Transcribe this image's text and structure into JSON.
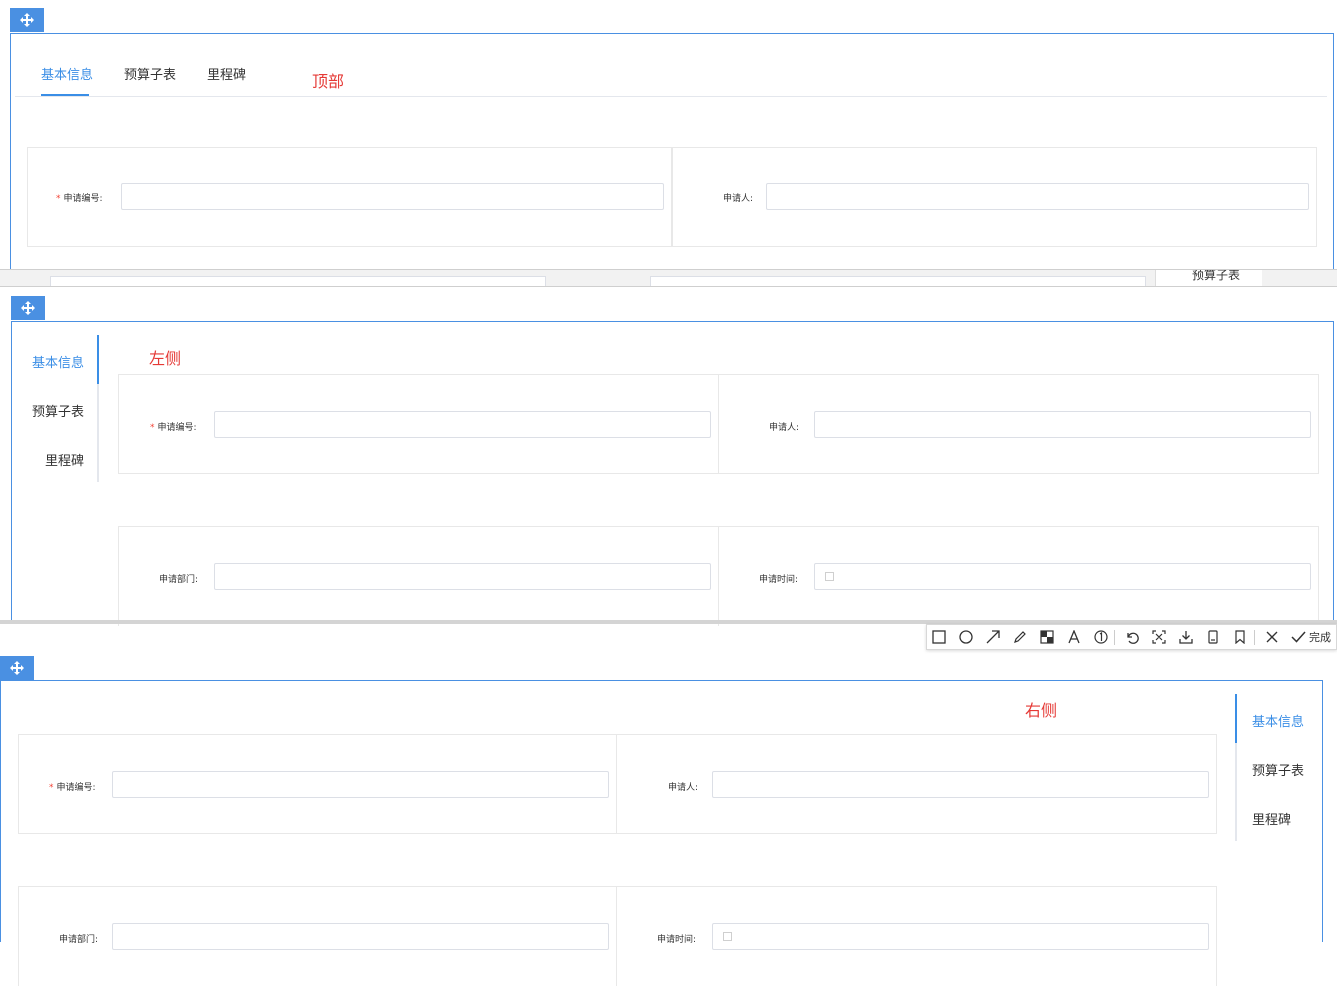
{
  "top_section": {
    "tabs": [
      "基本信息",
      "预算子表",
      "里程碑"
    ],
    "position_label": "顶部",
    "fields": {
      "apply_no_label": "申请编号:",
      "applicant_label": "申请人:"
    }
  },
  "left_section": {
    "tabs": [
      "基本信息",
      "预算子表",
      "里程碑"
    ],
    "position_label": "左侧",
    "fields": {
      "apply_no_label": "申请编号:",
      "applicant_label": "申请人:",
      "department_label": "申请部门:",
      "apply_time_label": "申请时间:"
    }
  },
  "right_section": {
    "tabs": [
      "基本信息",
      "预算子表",
      "里程碑"
    ],
    "position_label": "右侧",
    "fields": {
      "apply_no_label": "申请编号:",
      "applicant_label": "申请人:",
      "department_label": "申请部门:",
      "apply_time_label": "申请时间:"
    }
  },
  "fragment_text": "预算子表",
  "screenshot_toolbar": {
    "done_label": "完成",
    "tools": [
      "rectangle-icon",
      "circle-icon",
      "arrow-icon",
      "pencil-icon",
      "mosaic-icon",
      "text-icon",
      "number-icon",
      "undo-icon",
      "crop-icon",
      "download-icon",
      "save-icon",
      "bookmark-icon",
      "close-icon",
      "check-icon"
    ]
  },
  "colors": {
    "accent": "#3a8ee6",
    "panel_border": "#4a90e2",
    "annotation_red": "#e53935",
    "required_star": "#f44336"
  }
}
